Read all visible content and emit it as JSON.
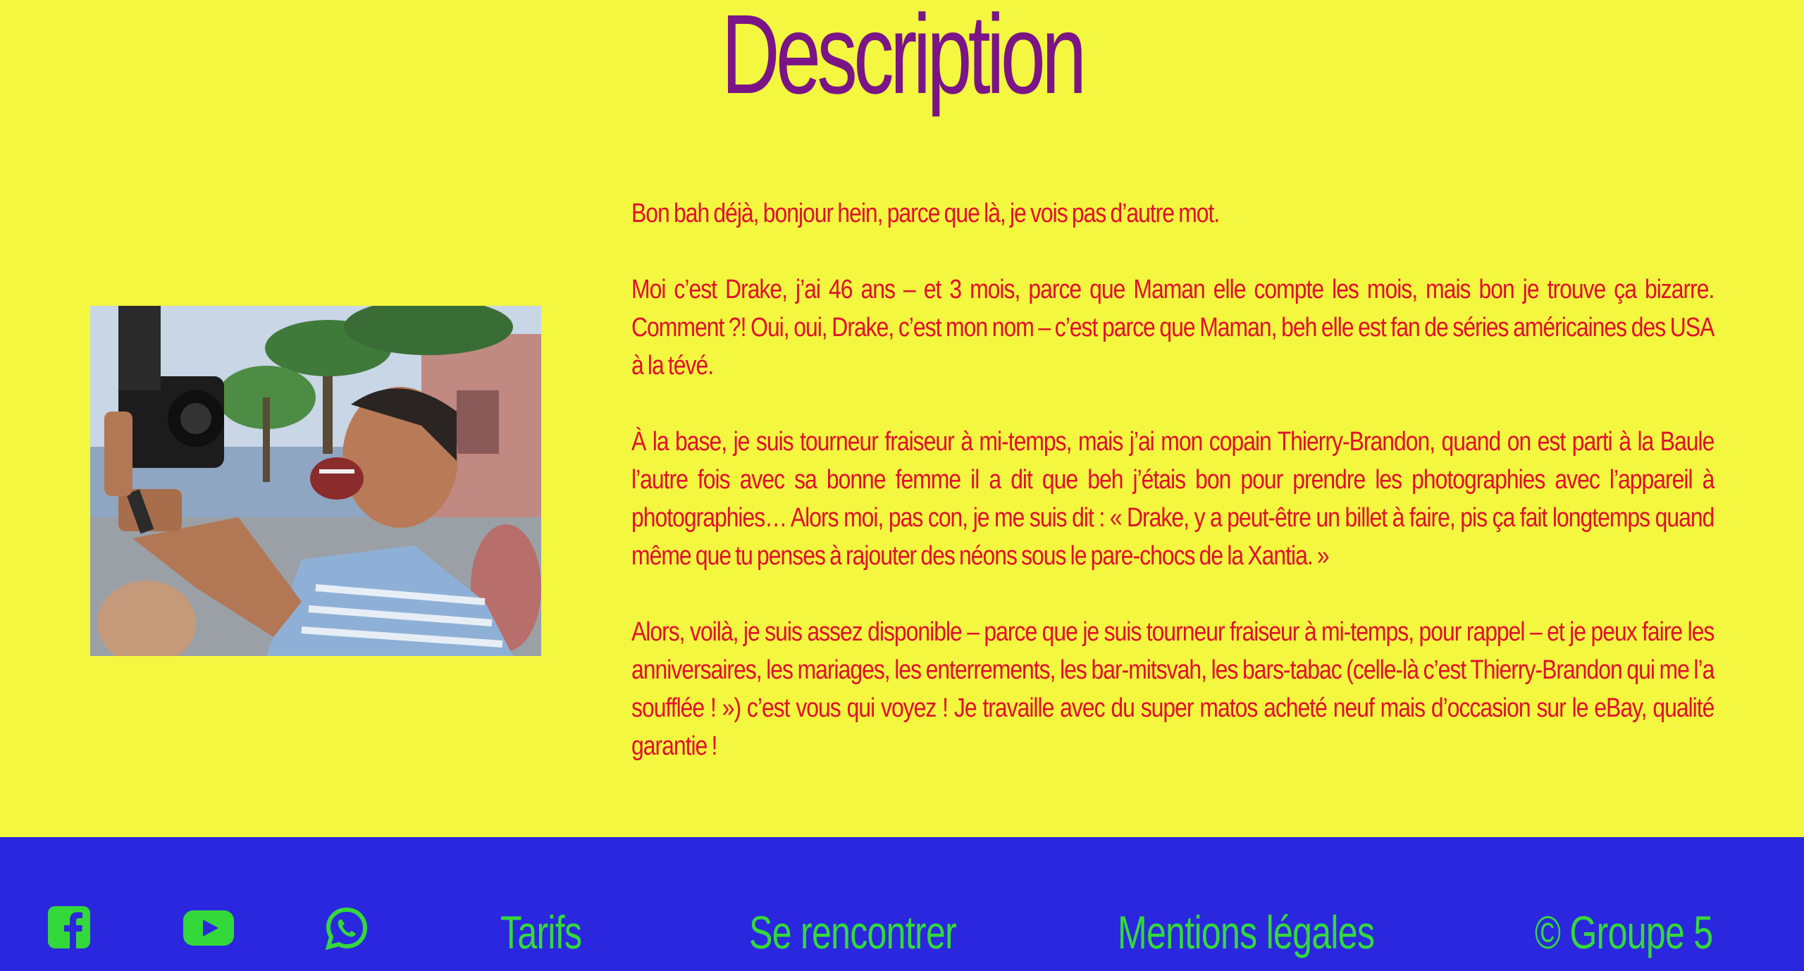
{
  "title": "Description",
  "paragraphs": [
    "Bon bah déjà, bonjour hein, parce que là, je vois pas d’autre mot.",
    "Moi c’est Drake, j’ai 46 ans – et 3 mois, parce que Maman elle compte les mois, mais bon je trouve ça bizarre. Comment ?! Oui, oui, Drake, c’est mon nom – c’est parce que Maman, beh elle est fan de séries américaines des USA à la tévé.",
    "À la base, je suis tourneur fraiseur à mi-temps, mais j’ai mon copain Thierry-Brandon, quand on est parti à la Baule l’autre fois avec sa bonne femme il a dit que beh j’étais bon pour prendre les photographies avec l’appareil à photographies… Alors moi, pas con, je me suis dit : « Drake, y a peut-être un billet à faire, pis ça fait longtemps quand même que tu penses à rajouter des néons sous le pare-chocs de la Xantia. »",
    "Alors, voilà, je suis assez disponible – parce que je suis tourneur fraiseur à mi-temps, pour rappel – et je peux faire les anniversaires, les mariages, les enterrements, les bar-mitsvah, les bars-tabac (celle-là c’est Thierry-Brandon qui me l’a soufflée ! ») c’est vous qui voyez ! Je travaille avec du super matos acheté neuf mais d’occasion sur le eBay, qualité garantie !"
  ],
  "footer": {
    "icons": [
      "facebook-icon",
      "youtube-icon",
      "whatsapp-icon"
    ],
    "links": [
      "Tarifs",
      "Se rencontrer",
      "Mentions légales"
    ],
    "copyright": "© Groupe 5"
  },
  "colors": {
    "background": "#f3f73f",
    "title": "#7a1487",
    "text": "#e0102e",
    "footer_background": "#2b27de",
    "footer_text": "#33d93a"
  }
}
